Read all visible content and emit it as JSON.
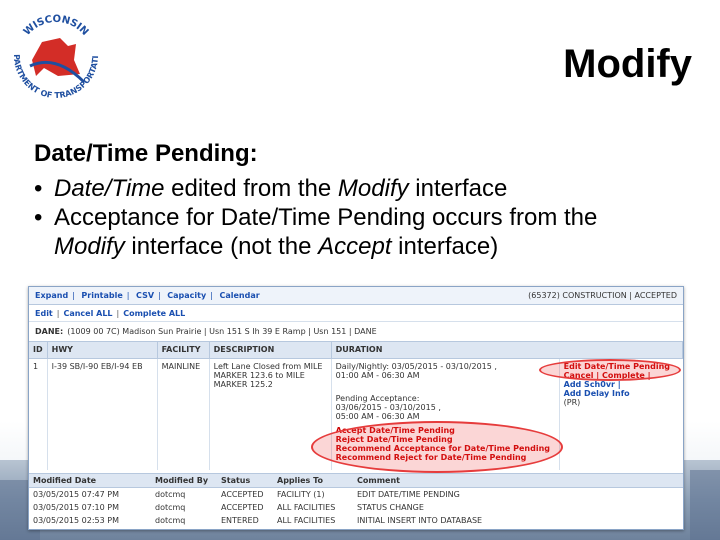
{
  "slide": {
    "title": "Modify",
    "heading": "Date/Time Pending:",
    "bullet1": {
      "italic": "Date/Time",
      "rest": " edited from the ",
      "italic2": "Modify",
      "end": " interface"
    },
    "bullet2": {
      "line1": "Acceptance for Date/Time Pending occurs from the",
      "italic": "Modify",
      "mid": " interface (not the ",
      "italic2": "Accept",
      "end": " interface)"
    }
  },
  "logo": {
    "top_text": "WISCONSIN",
    "left_text": "DEPARTMENT",
    "bottom_text": "OF TRANSPORTATION",
    "colors": {
      "state": "#d32d27",
      "ring": "#1f4fa0"
    }
  },
  "app": {
    "toolbar": {
      "links": [
        "Expand",
        "Printable",
        "CSV",
        "Capacity",
        "Calendar"
      ],
      "status": "(65372) CONSTRUCTION | ACCEPTED"
    },
    "actions": [
      "Edit",
      "Cancel ALL",
      "Complete ALL"
    ],
    "route": {
      "label": "DANE:",
      "text": "(1009 00 7C) Madison  Sun Prairie | Usn 151 S  Ih 39 E Ramp | Usn 151 | DANE"
    },
    "columns": [
      "ID",
      "HWY",
      "FACILITY",
      "DESCRIPTION",
      "DURATION"
    ],
    "row": {
      "id": "1",
      "hwy": "I-39 SB/I-90 EB/I-94 EB",
      "facility": "MAINLINE",
      "description": [
        "Left Lane Closed from MILE",
        "MARKER 123.6 to MILE",
        "MARKER 125.2"
      ],
      "duration": [
        "Daily/Nightly:  03/05/2015  -  03/10/2015 ,",
        "01:00 AM  -  06:30 AM"
      ],
      "pending_label": "Pending Acceptance:",
      "pending": [
        "03/06/2015  -  03/10/2015 ,",
        "05:00 AM  -  06:30 AM"
      ],
      "pending_actions": [
        "Accept Date/Time Pending",
        "Reject Date/Time Pending",
        "Recommend Acceptance for Date/Time Pending",
        "Recommend Reject for Date/Time Pending"
      ],
      "right_actions": {
        "red": [
          "Edit Date/Time Pending",
          "Cancel | Complete |"
        ],
        "blue": [
          "Add Sch0vr |",
          "Add Delay Info"
        ],
        "note": "(PR)"
      }
    },
    "history": {
      "columns": [
        "Modified Date",
        "Modified By",
        "Status",
        "Applies To",
        "Comment"
      ],
      "rows": [
        [
          "03/05/2015 07:47 PM",
          "dotcmq",
          "ACCEPTED",
          "FACILITY (1)",
          "EDIT DATE/TIME PENDING"
        ],
        [
          "03/05/2015 07:10 PM",
          "dotcmq",
          "ACCEPTED",
          "ALL FACILITIES",
          "STATUS CHANGE"
        ],
        [
          "03/05/2015 02:53 PM",
          "dotcmq",
          "ENTERED",
          "ALL FACILITIES",
          "INITIAL INSERT INTO DATABASE"
        ]
      ]
    }
  }
}
